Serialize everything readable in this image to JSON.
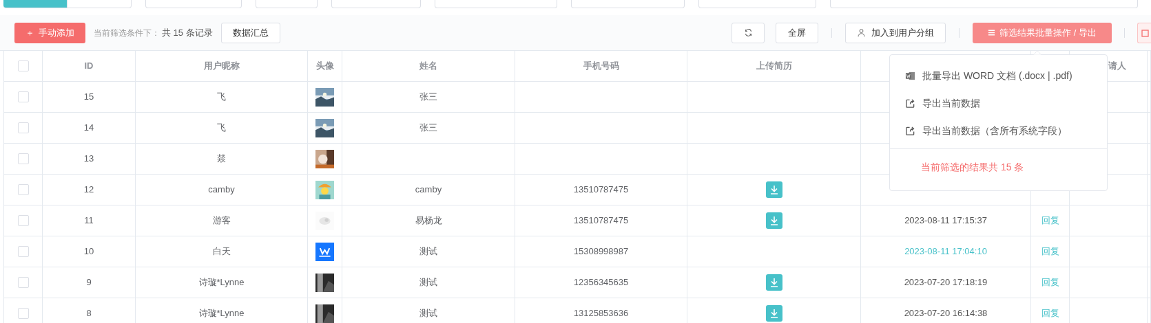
{
  "filter_tabs": [
    {
      "selected": true
    },
    {
      "selected": false
    }
  ],
  "toolbar": {
    "add_button": {
      "icon": "＋",
      "label": "手动添加"
    },
    "filter_label": "当前筛选条件下：",
    "record_count": "共 15 条记录",
    "summary_button": "数据汇总",
    "fullscreen_button": "全屏",
    "group_button": "加入到用户分组",
    "bulk_button": "筛选结果批量操作 / 导出"
  },
  "table": {
    "header_checkbox": {
      "checked": false
    },
    "columns": [
      "ID",
      "用户昵称",
      "头像",
      "姓名",
      "手机号码",
      "上传简历",
      "",
      "",
      "请人"
    ],
    "rows": [
      {
        "checked": false,
        "id": "15",
        "nickname": "飞",
        "name": "张三",
        "resume": false
      },
      {
        "checked": false,
        "id": "14",
        "nickname": "飞",
        "name": "张三",
        "resume": false
      },
      {
        "checked": false,
        "id": "13",
        "nickname": "燚",
        "resume": false
      },
      {
        "checked": false,
        "id": "12",
        "nickname": "camby",
        "name": "camby",
        "phone": "13510787475",
        "resume": true
      },
      {
        "checked": false,
        "id": "11",
        "nickname": "游客",
        "name": "易杨龙",
        "phone": "13510787475",
        "resume": true,
        "time": "2023-08-11 17:15:37",
        "time_highlighted": false,
        "reply": "回复"
      },
      {
        "checked": false,
        "id": "10",
        "nickname": "白天",
        "name": "测试",
        "phone": "15308998987",
        "resume": false,
        "time": "2023-08-11 17:04:10",
        "time_highlighted": true,
        "reply": "回复"
      },
      {
        "checked": false,
        "id": "9",
        "nickname": "诗璇*Lynne",
        "name": "测试",
        "phone": "12356345635",
        "resume": true,
        "time": "2023-07-20 17:18:19",
        "time_highlighted": false,
        "reply": "回复"
      },
      {
        "checked": false,
        "id": "8",
        "nickname": "诗璇*Lynne",
        "name": "测试",
        "phone": "13125853636",
        "resume": true,
        "time": "2023-07-20 16:14:38",
        "time_highlighted": false,
        "reply": "回复"
      }
    ]
  },
  "dropdown": {
    "items": [
      {
        "kind": "word",
        "label": "批量导出 WORD 文档 (.docx | .pdf)"
      },
      {
        "kind": "export",
        "label": "导出当前数据"
      },
      {
        "kind": "export",
        "label": "导出当前数据（含所有系统字段）"
      }
    ],
    "footer": "当前筛选的结果共 15 条"
  }
}
